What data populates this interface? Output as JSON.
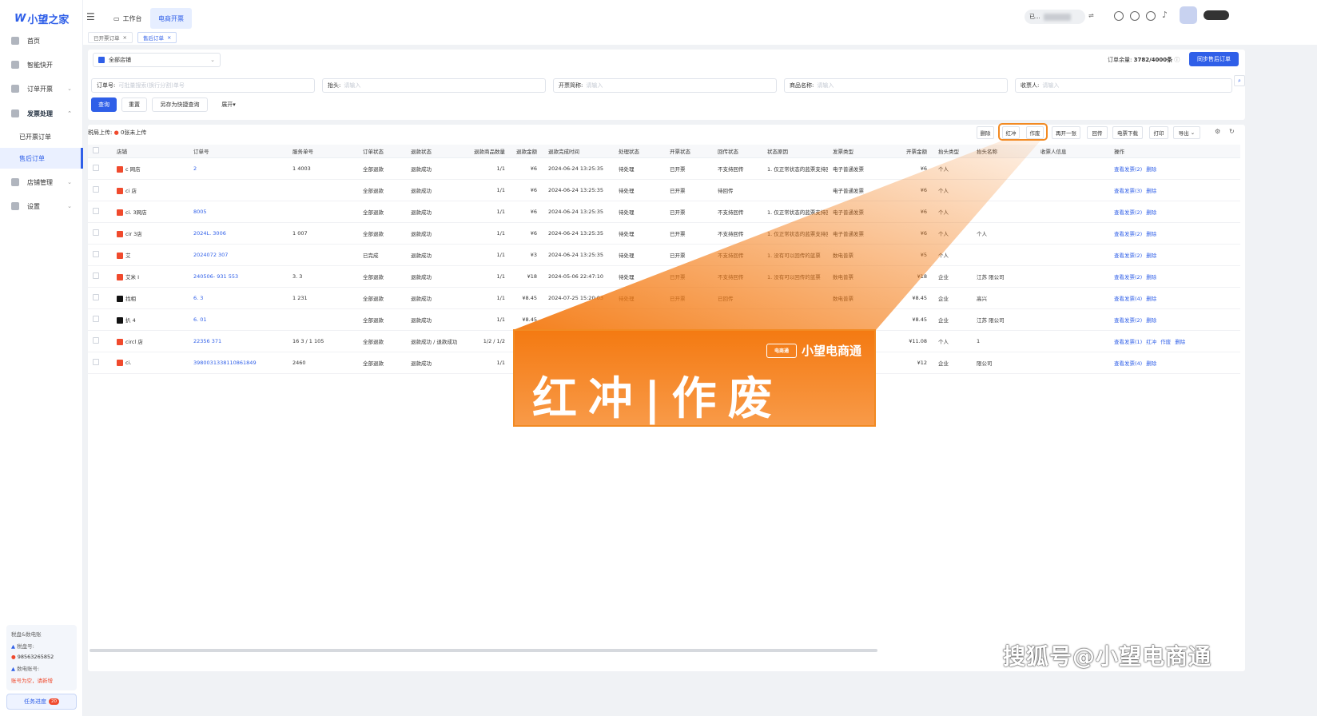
{
  "app": {
    "logo_text": "小望之家"
  },
  "sidebar": {
    "items": [
      {
        "label": "首页"
      },
      {
        "label": "智能快开"
      },
      {
        "label": "订单开票"
      },
      {
        "label": "发票处理"
      },
      {
        "label": "店铺管理"
      },
      {
        "label": "设置"
      }
    ],
    "sub_items": [
      {
        "label": "已开票订单"
      },
      {
        "label": "售后订单"
      }
    ],
    "account": {
      "title": "税盘&数电账",
      "tax_label": "税盘号:",
      "tax_no": "98563265852",
      "digital_label": "数电账号:",
      "digital_warn": "账号为空，请新增"
    },
    "task_button": "任务进度",
    "task_badge": "20"
  },
  "topbar": {
    "tabs": [
      {
        "label": "工作台"
      },
      {
        "label": "电商开票"
      }
    ],
    "user_masked": "已..."
  },
  "page_tabs": [
    {
      "label": "已开票订单"
    },
    {
      "label": "售后订单"
    }
  ],
  "filters": {
    "shop_select": "全部店铺",
    "remaining_label": "订单余量:",
    "remaining_value": "3782/4000条",
    "sync_button": "同步售后订单",
    "order_no_label": "订单号:",
    "order_no_placeholder": "可批量搜索(换行分割)单号",
    "header_label": "抬头:",
    "header_placeholder": "请输入",
    "invoice_short_label": "开票简称:",
    "invoice_short_placeholder": "请输入",
    "product_label": "商品名称:",
    "product_placeholder": "请输入",
    "receiver_label": "收票人:",
    "receiver_placeholder": "请输入",
    "query": "查询",
    "reset": "重置",
    "save_quick": "另存为快捷查询",
    "expand": "展开"
  },
  "toolbar": {
    "tax_upload_label": "税局上传:",
    "tax_upload_value": "0张未上传",
    "buttons": [
      "删除",
      "红冲",
      "作废",
      "再开一张",
      "回传",
      "电票下载",
      "打印",
      "导出"
    ]
  },
  "table": {
    "columns": [
      "店铺",
      "订单号",
      "服务单号",
      "订单状态",
      "退款状态",
      "退款商品数量",
      "退款金额",
      "退款完成时间",
      "处理状态",
      "开票状态",
      "回传状态",
      "状态原因",
      "发票类型",
      "开票金额",
      "抬头类型",
      "抬头名称",
      "收票人信息",
      "操作"
    ],
    "rows": [
      {
        "shop": "c 网店",
        "order": "2",
        "service": "1 4003",
        "order_status": "全部退款",
        "refund_status": "退款成功",
        "qty": "1/1",
        "amount": "¥6",
        "time": "2024-06-24 13:25:35",
        "process": "待处理",
        "invoice_status": "已开票",
        "return_status": "不支持回传",
        "reason": "1. 仅正常状态的蓝票支持回传",
        "invoice_type": "电子普通发票",
        "inv_amount": "¥6",
        "head_type": "个人",
        "head_name": "",
        "actions": [
          "查看发票(2)",
          "删除"
        ]
      },
      {
        "shop": "ci 店",
        "order": "",
        "service": "",
        "order_status": "全部退款",
        "refund_status": "退款成功",
        "qty": "1/1",
        "amount": "¥6",
        "time": "2024-06-24 13:25:35",
        "process": "待处理",
        "invoice_status": "已开票",
        "return_status": "待回传",
        "reason": "",
        "invoice_type": "电子普通发票",
        "inv_amount": "¥6",
        "head_type": "个人",
        "head_name": "",
        "actions": [
          "查看发票(3)",
          "删除"
        ]
      },
      {
        "shop": "ci. 3网店",
        "order": "8005",
        "service": "",
        "order_status": "全部退款",
        "refund_status": "退款成功",
        "qty": "1/1",
        "amount": "¥6",
        "time": "2024-06-24 13:25:35",
        "process": "待处理",
        "invoice_status": "已开票",
        "return_status": "不支持回传",
        "reason": "1. 仅正常状态的蓝票支持回传",
        "invoice_type": "电子普通发票",
        "inv_amount": "¥6",
        "head_type": "个人",
        "head_name": "",
        "actions": [
          "查看发票(2)",
          "删除"
        ]
      },
      {
        "shop": "cir 3店",
        "order": "2024L. 3006",
        "service": "1 007",
        "order_status": "全部退款",
        "refund_status": "退款成功",
        "qty": "1/1",
        "amount": "¥6",
        "time": "2024-06-24 13:25:35",
        "process": "待处理",
        "invoice_status": "已开票",
        "return_status": "不支持回传",
        "reason": "1. 仅正常状态的蓝票支持回传",
        "invoice_type": "电子普通发票",
        "inv_amount": "¥6",
        "head_type": "个人",
        "head_name": "个人",
        "actions": [
          "查看发票(2)",
          "删除"
        ]
      },
      {
        "shop": "艾",
        "order": "2024072 307",
        "service": "",
        "order_status": "已完成",
        "refund_status": "退款成功",
        "qty": "1/1",
        "amount": "¥3",
        "time": "2024-06-24 13:25:35",
        "process": "待处理",
        "invoice_status": "已开票",
        "return_status": "不支持回传",
        "reason": "1. 没有可以回传的蓝票",
        "invoice_type": "数电普票",
        "inv_amount": "¥5",
        "head_type": "个人",
        "head_name": "",
        "actions": [
          "查看发票(2)",
          "删除"
        ]
      },
      {
        "shop": "艾米 I",
        "order": "240506- 931 553",
        "service": "3. 3",
        "order_status": "全部退款",
        "refund_status": "退款成功",
        "qty": "1/1",
        "amount": "¥18",
        "time": "2024-05-06 22:47:10",
        "process": "待处理",
        "invoice_status": "已开票",
        "return_status": "不支持回传",
        "reason": "1. 没有可以回传的蓝票",
        "invoice_type": "数电普票",
        "inv_amount": "¥18",
        "head_type": "企业",
        "head_name": "江苏 限公司",
        "actions": [
          "查看发票(2)",
          "删除"
        ]
      },
      {
        "shop": "找相",
        "order": "6. 3",
        "service": "1 231",
        "order_status": "全部退款",
        "refund_status": "退款成功",
        "qty": "1/1",
        "amount": "¥8.45",
        "time": "2024-07-25 15:20:03",
        "process": "待处理",
        "invoice_status": "已开票",
        "return_status": "已回传",
        "reason": "",
        "invoice_type": "数电普票",
        "inv_amount": "¥8.45",
        "head_type": "企业",
        "head_name": "高兴",
        "actions": [
          "查看发票(4)",
          "删除"
        ]
      },
      {
        "shop": "扒 4",
        "order": "6. 01",
        "service": "",
        "order_status": "全部退款",
        "refund_status": "退款成功",
        "qty": "1/1",
        "amount": "¥8.45",
        "time": "",
        "process": "",
        "invoice_status": "",
        "return_status": "",
        "reason": "",
        "invoice_type": "",
        "inv_amount": "¥8.45",
        "head_type": "企业",
        "head_name": "江苏 限公司",
        "actions": [
          "查看发票(2)",
          "删除"
        ]
      },
      {
        "shop": "circl 店",
        "order": "22356 371",
        "service": "16 3 / 1 105",
        "order_status": "全部退款",
        "refund_status": "退款成功 / 退款成功",
        "qty": "1/2 / 1/2",
        "amount": "",
        "time": "",
        "process": "",
        "invoice_status": "",
        "return_status": "",
        "reason": "",
        "invoice_type": "",
        "inv_amount": "¥11.08",
        "head_type": "个人",
        "head_name": "1",
        "actions": [
          "查看发票(1)",
          "红冲",
          "作废",
          "删除"
        ]
      },
      {
        "shop": "ci.",
        "order": "3980031338110861849",
        "service": "2460",
        "order_status": "全部退款",
        "refund_status": "退款成功",
        "qty": "1/1",
        "amount": "",
        "time": "",
        "process": "",
        "invoice_status": "",
        "return_status": "",
        "reason": "",
        "invoice_type": "",
        "inv_amount": "¥12",
        "head_type": "企业",
        "head_name": "限公司",
        "actions": [
          "查看发票(4)",
          "删除"
        ]
      }
    ]
  },
  "banner": {
    "brand_badge": "电商通",
    "brand": "小望电商通",
    "headline": "红冲|作废"
  },
  "watermark": "搜狐号@小望电商通",
  "colors": {
    "accent": "#2f5fe8",
    "highlight": "#f28a22",
    "danger": "#f04a2d"
  }
}
